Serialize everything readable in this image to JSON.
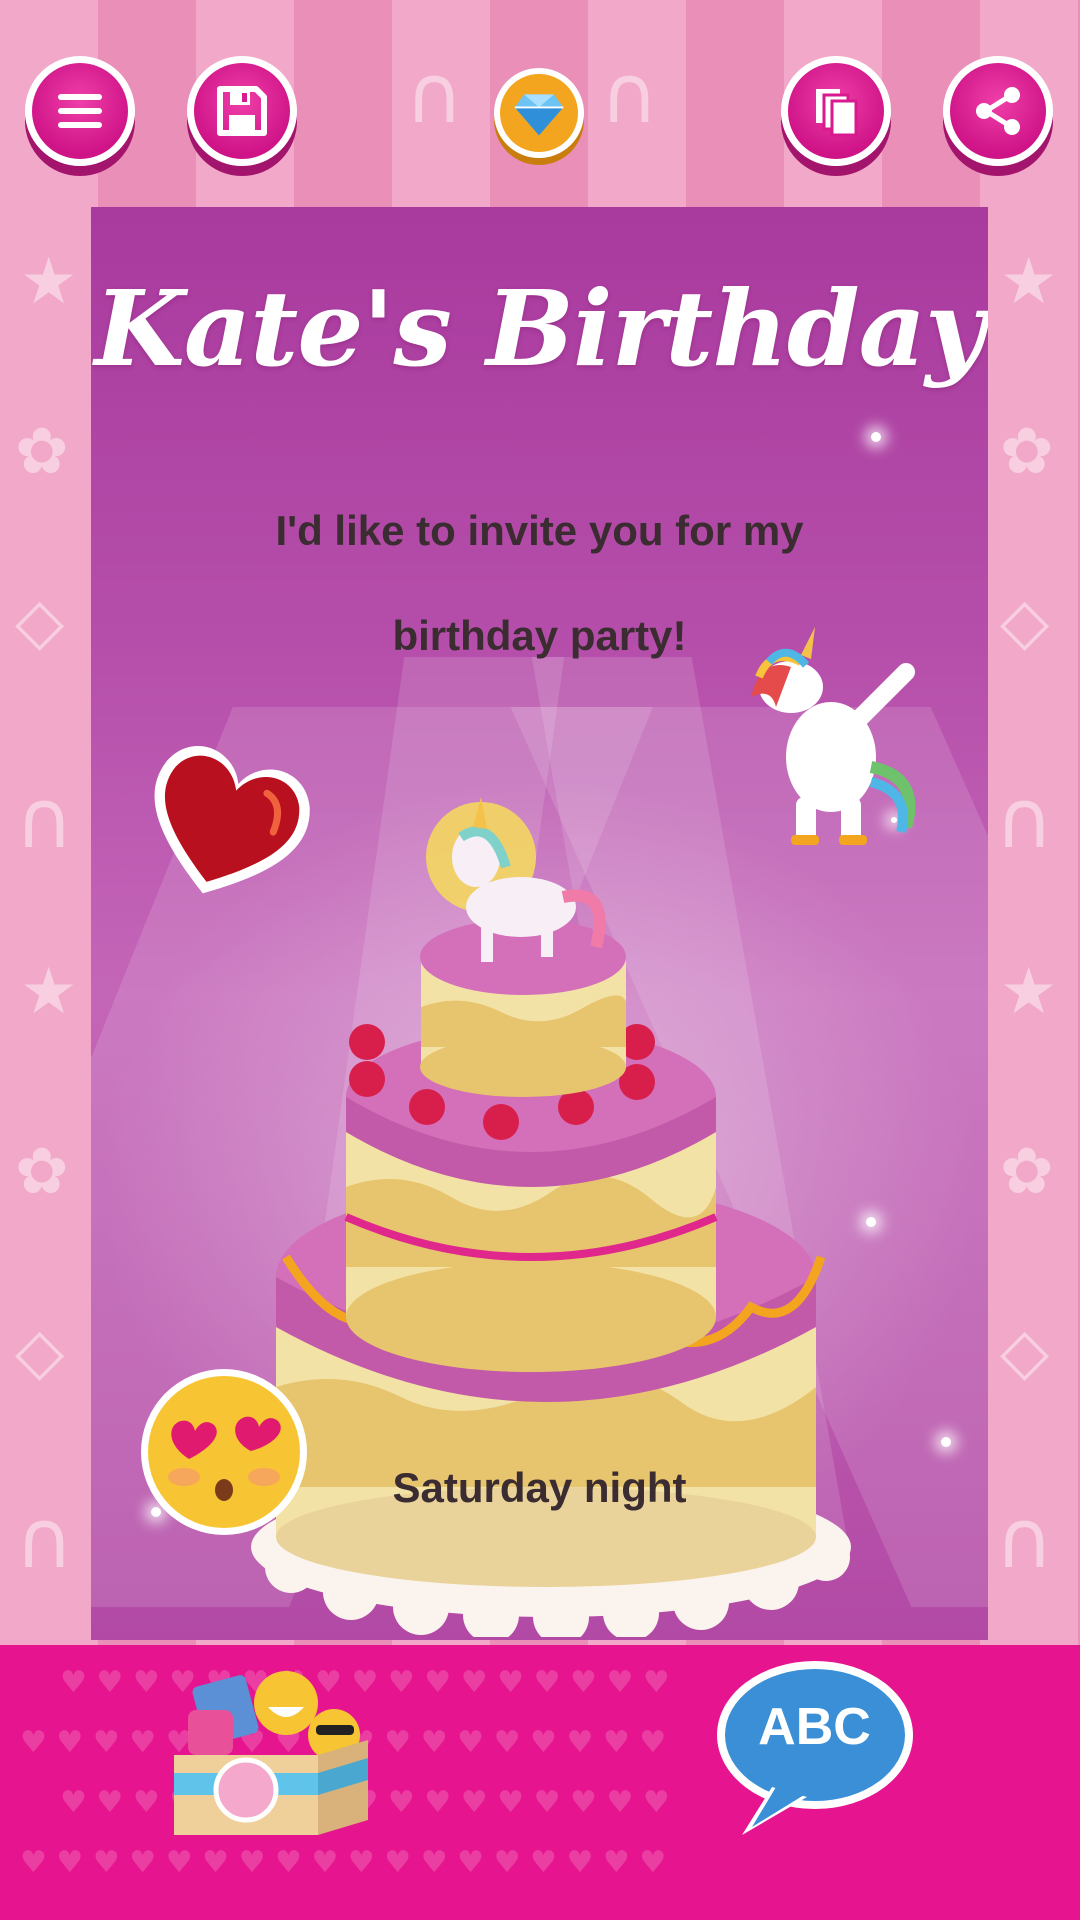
{
  "toolbar": {
    "menu_icon": "hamburger-menu-icon",
    "save_icon": "floppy-disk-icon",
    "premium_icon": "diamond-icon",
    "copy_icon": "copy-pages-icon",
    "share_icon": "share-icon"
  },
  "card": {
    "title": "Kate's Birthday",
    "invite_line1": "I'd like to invite you for my",
    "invite_line2": "birthday party!",
    "when_text": "Saturday night"
  },
  "bottom": {
    "stickers_icon": "sticker-box-icon",
    "text_button_label": "ABC"
  },
  "colors": {
    "accent_pink": "#e6148e",
    "card_purple": "#b54eaa",
    "button_pink": "#d8198f",
    "text_dark": "#3a2c30",
    "speech_blue": "#3b8fd6"
  }
}
